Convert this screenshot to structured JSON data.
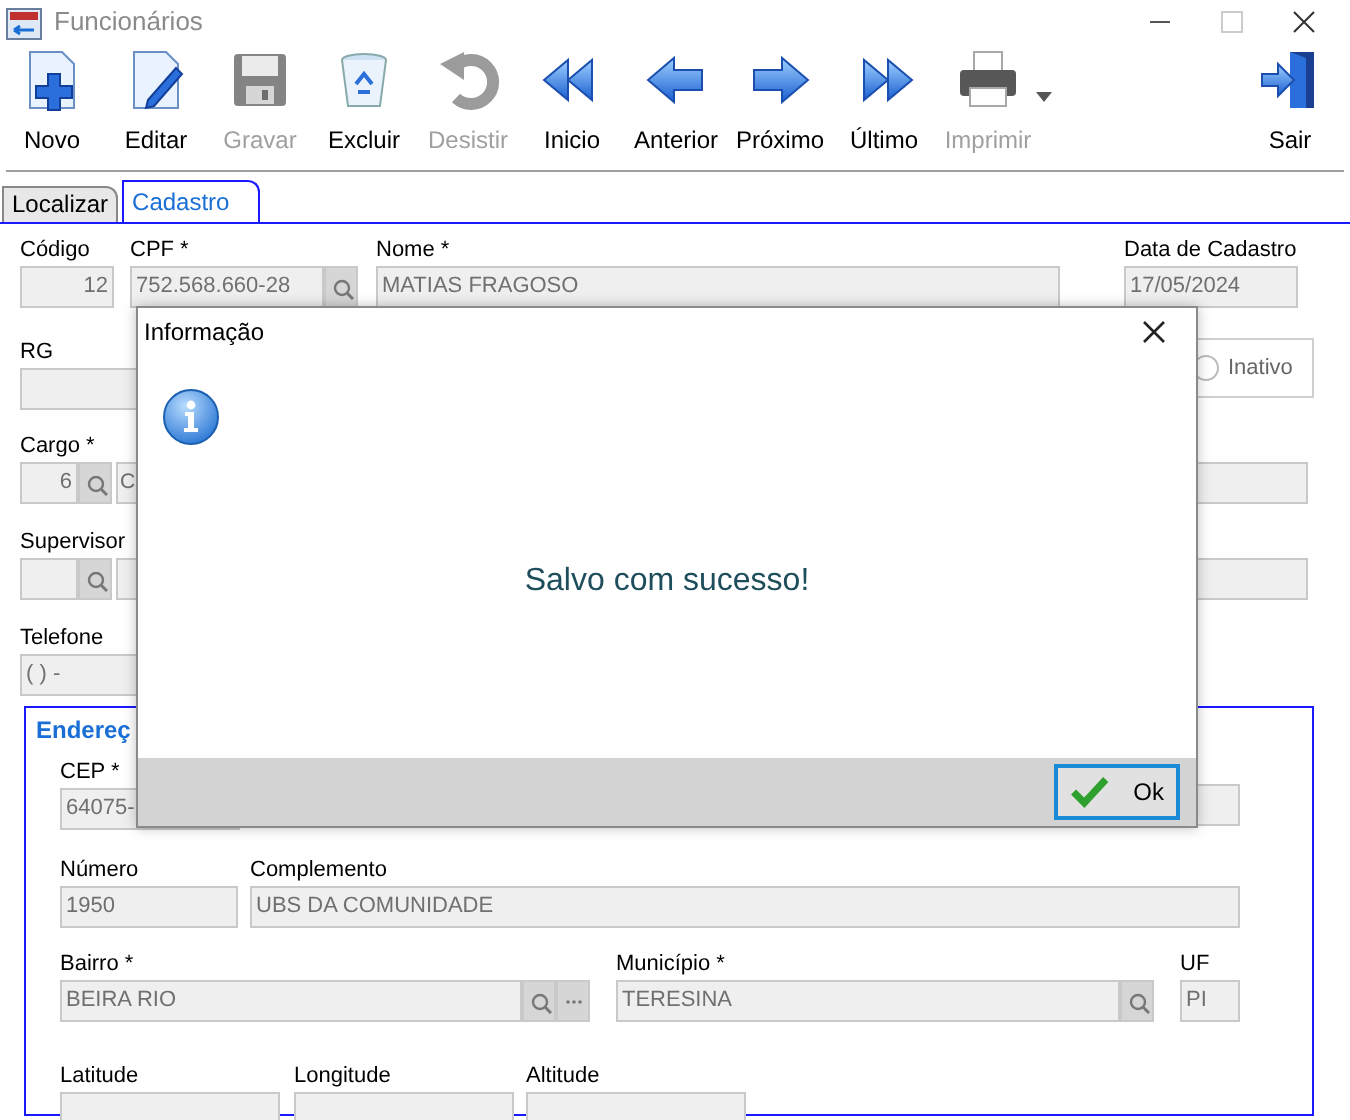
{
  "window": {
    "title": "Funcionários"
  },
  "toolbar": [
    {
      "label": "Novo",
      "disabled": false
    },
    {
      "label": "Editar",
      "disabled": false
    },
    {
      "label": "Gravar",
      "disabled": true
    },
    {
      "label": "Excluir",
      "disabled": false
    },
    {
      "label": "Desistir",
      "disabled": true
    },
    {
      "label": "Inicio",
      "disabled": false
    },
    {
      "label": "Anterior",
      "disabled": false
    },
    {
      "label": "Próximo",
      "disabled": false
    },
    {
      "label": "Último",
      "disabled": false
    },
    {
      "label": "Imprimir",
      "disabled": true
    }
  ],
  "exit_button": {
    "label": "Sair"
  },
  "tabs": [
    {
      "label": "Localizar",
      "selected": false
    },
    {
      "label": "Cadastro",
      "selected": true
    }
  ],
  "form": {
    "codigo": {
      "label": "Código",
      "value": "12"
    },
    "cpf": {
      "label": "CPF *",
      "value": "752.568.660-28"
    },
    "nome": {
      "label": "Nome *",
      "value": "MATIAS FRAGOSO"
    },
    "data_cadastro": {
      "label": "Data de Cadastro",
      "value": "17/05/2024"
    },
    "rg": {
      "label": "RG"
    },
    "status_option": {
      "label": "Inativo",
      "checked": false
    },
    "cargo": {
      "label": "Cargo *",
      "value": "6",
      "description": "C"
    },
    "supervisor": {
      "label": "Supervisor"
    },
    "telefone": {
      "label": "Telefone",
      "value": "( )   -"
    }
  },
  "address": {
    "title": "Endereç",
    "cep": {
      "label": "CEP *",
      "value": "64075-"
    },
    "numero": {
      "label": "Número",
      "value": "1950"
    },
    "complemento": {
      "label": "Complemento",
      "value": "UBS DA COMUNIDADE"
    },
    "bairro": {
      "label": "Bairro *",
      "value": "BEIRA RIO"
    },
    "municipio": {
      "label": "Município *",
      "value": "TERESINA"
    },
    "uf": {
      "label": "UF",
      "value": "PI"
    },
    "latitude": {
      "label": "Latitude"
    },
    "longitude": {
      "label": "Longitude"
    },
    "altitude": {
      "label": "Altitude"
    }
  },
  "dialog": {
    "title": "Informação",
    "message": "Salvo com sucesso!",
    "button": "Ok"
  }
}
